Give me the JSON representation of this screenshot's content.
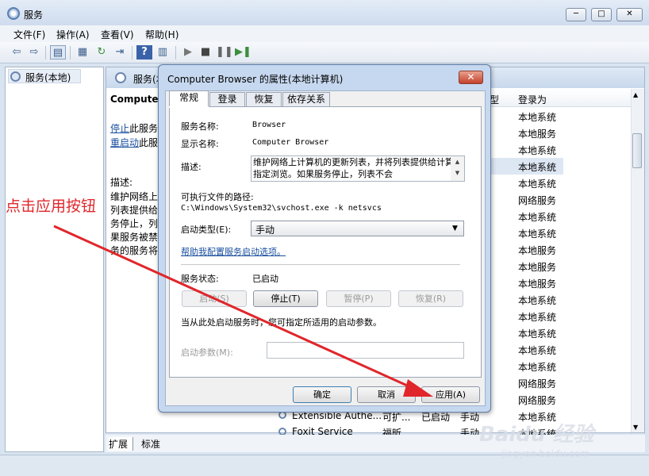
{
  "window": {
    "title": "服务",
    "min": "─",
    "max": "□",
    "close": "✕"
  },
  "menu": [
    "文件(F)",
    "操作(A)",
    "查看(V)",
    "帮助(H)"
  ],
  "tree": {
    "item": "服务(本地)"
  },
  "pane": {
    "title": "服务(本地)",
    "detail_name": "Computer",
    "stop_link": "停止",
    "stop_suffix": "此服务",
    "restart_link": "重启动",
    "restart_suffix": "此服务",
    "desc_label": "描述:",
    "desc_lines": [
      "维护网络上",
      "列表提供给",
      "务停止，列",
      "果服务被禁",
      "务的服务将"
    ],
    "col_type": "型",
    "col_logon": "登录为",
    "logon_values": [
      "本地系统",
      "本地服务",
      "本地系统",
      "本地系统",
      "本地系统",
      "网络服务",
      "本地系统",
      "本地系统",
      "本地服务",
      "本地服务",
      "本地服务",
      "本地系统",
      "本地系统",
      "本地系统",
      "本地系统",
      "本地系统",
      "网络服务",
      "网络服务",
      "本地系统",
      "本地系统"
    ],
    "bottom_rows": [
      {
        "name": "Extensible Authe...",
        "desc": "可扩...",
        "status": "已启动",
        "startup": "手动"
      },
      {
        "name": "Foxit Service",
        "desc": "福昕...",
        "status": "",
        "startup": "手动"
      }
    ],
    "tabs": [
      "扩展",
      "标准"
    ]
  },
  "dialog": {
    "title": "Computer Browser 的属性(本地计算机)",
    "close": "✕",
    "tabs": [
      "常规",
      "登录",
      "恢复",
      "依存关系"
    ],
    "service_name_label": "服务名称:",
    "service_name": "Browser",
    "display_name_label": "显示名称:",
    "display_name": "Computer Browser",
    "desc_label": "描述:",
    "desc_text": "维护网络上计算机的更新列表，并将列表提供给计算机指定浏览。如果服务停止，列表不会",
    "path_label": "可执行文件的路径:",
    "path": "C:\\Windows\\System32\\svchost.exe -k netsvcs",
    "startup_label": "启动类型(E):",
    "startup_value": "手动",
    "help_link": "帮助我配置服务启动选项。",
    "status_label": "服务状态:",
    "status_value": "已启动",
    "btn_start": "启动(S)",
    "btn_stop": "停止(T)",
    "btn_pause": "暂停(P)",
    "btn_resume": "恢复(R)",
    "hint": "当从此处启动服务时，您可指定所适用的启动参数。",
    "param_label": "启动参数(M):",
    "ok": "确定",
    "cancel": "取消",
    "apply": "应用(A)"
  },
  "annotation": {
    "text": "点击应用按钮",
    "color": "#e0262b"
  },
  "watermark": {
    "main": "Baidu 经验",
    "sub": "jingyan.baidu.com"
  }
}
